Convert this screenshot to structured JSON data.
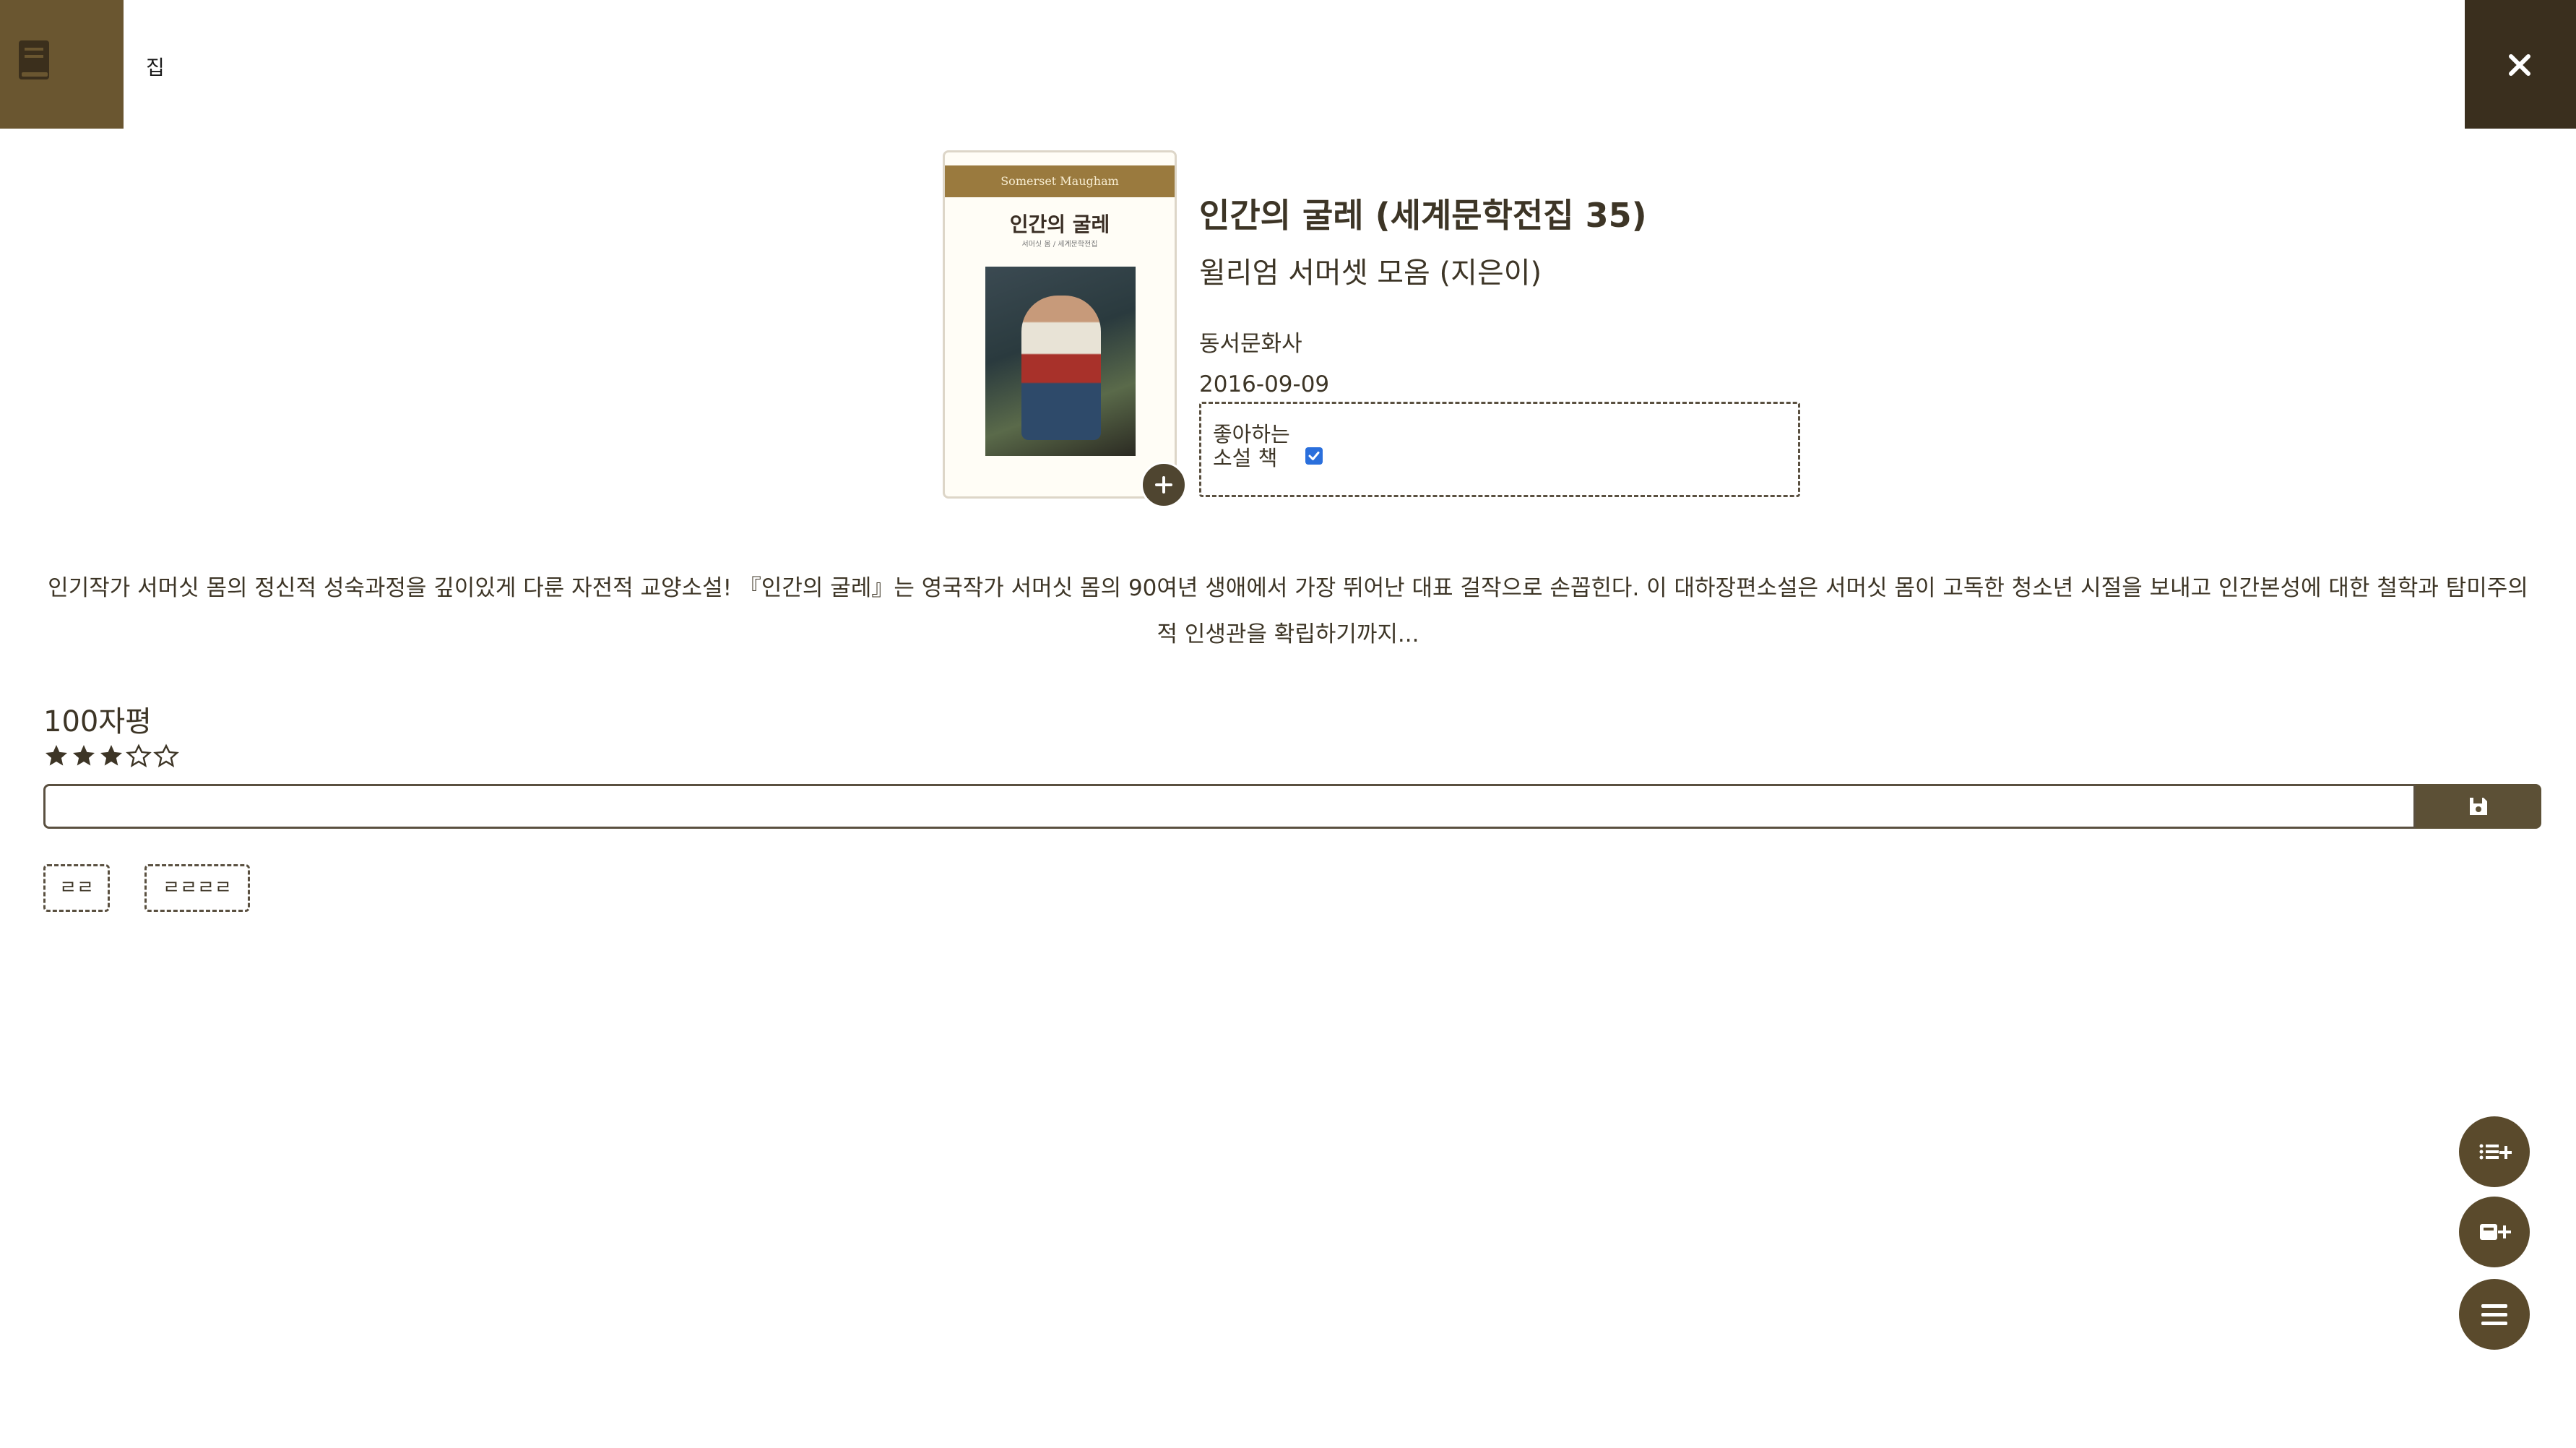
{
  "header": {
    "logo_icon": "book-icon",
    "home_label": "집",
    "close_icon": "close-icon"
  },
  "book": {
    "cover": {
      "band_text": "Somerset Maugham",
      "title_text": "인간의 굴레",
      "subtitle_text": "서머싯 몸 / 세계문학전집"
    },
    "title": "인간의 굴레 (세계문학전집 35)",
    "author": "윌리엄 서머셋 모옴 (지은이)",
    "publisher": "동서문화사",
    "date": "2016-09-09",
    "shelf": {
      "label": "좋아하는 소설 책",
      "checked": true
    },
    "description": "인기작가 서머싯 몸의 정신적 성숙과정을 깊이있게 다룬 자전적 교양소설! 『인간의 굴레』는 영국작가 서머싯 몸의 90여년 생애에서 가장 뛰어난 대표 걸작으로 손꼽힌다. 이 대하장편소설은 서머싯 몸이 고독한 청소년 시절을 보내고 인간본성에 대한 철학과 탐미주의적 인생관을 확립하기까지..."
  },
  "review": {
    "heading": "100자평",
    "rating": 3,
    "max_rating": 5,
    "input_value": "",
    "save_icon": "floppy-disk-icon"
  },
  "tags": [
    "ㄹㄹ",
    "ㄹㄹㄹㄹ"
  ],
  "fabs": [
    "list-add-icon",
    "book-add-icon",
    "menu-icon"
  ],
  "colors": {
    "brand_gold": "#6a5630",
    "brand_dark": "#3a2f1e",
    "fab": "#5a4a2c",
    "text": "#3d3526",
    "checkbox": "#2a6fdc"
  }
}
